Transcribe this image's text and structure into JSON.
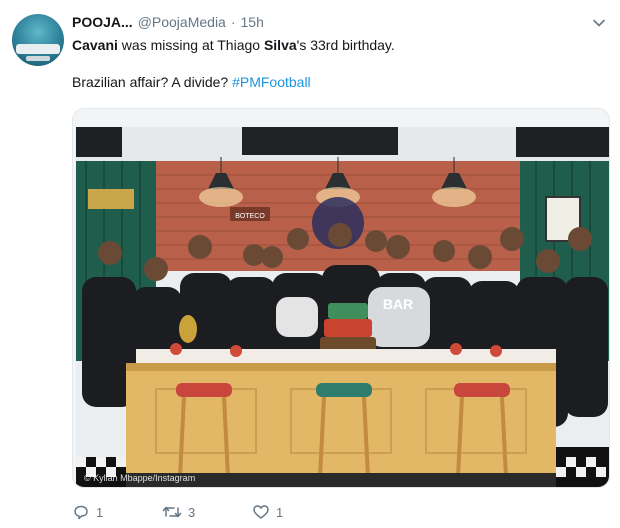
{
  "author": {
    "name": "POOJA...",
    "handle": "@PoojaMedia",
    "separator": "·",
    "time": "15h"
  },
  "tweet": {
    "part1_bold": "Cavani",
    "part2": " was missing at Thiago ",
    "part3_bold": "Silva",
    "part4": "'s 33rd birthday.",
    "line2_text": "Brazilian affair? A divide? ",
    "hashtag": "#PMFootball"
  },
  "media": {
    "photo_credit": "© Kylian Mbappe/Instagram",
    "signs": {
      "boteco": "BOTECO",
      "bar": "BAR"
    }
  },
  "actions": {
    "reply": {
      "icon": "reply-icon",
      "count": "1"
    },
    "retweet": {
      "icon": "retweet-icon",
      "count": "3"
    },
    "like": {
      "icon": "heart-icon",
      "count": "1"
    }
  },
  "colors": {
    "link": "#1b95e0",
    "secondary_text": "#657786",
    "wall_green": "#1f5e4d",
    "brick": "#b8604a",
    "counter": "#e2b866"
  }
}
